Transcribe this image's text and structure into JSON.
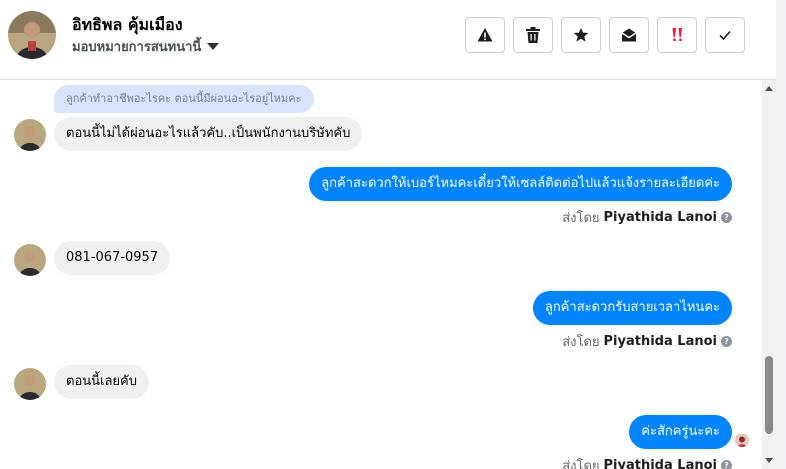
{
  "header": {
    "contact_name": "อิทธิพล คุ้มเมือง",
    "assign_label": "มอบหมายการสนทนานี้",
    "actions": [
      {
        "name": "alert-icon",
        "label": "spam"
      },
      {
        "name": "trash-icon",
        "label": "delete"
      },
      {
        "name": "star-icon",
        "label": "star"
      },
      {
        "name": "envelope-open-icon",
        "label": "mark unread"
      },
      {
        "name": "double-exclamation-icon",
        "label": "follow up"
      },
      {
        "name": "check-icon",
        "label": "done"
      }
    ],
    "accent_red": "#e41e3f"
  },
  "messages": {
    "quote_text": "ลูกค้าทำอาชีพอะไรคะ ตอนนี้มีผ่อนอะไรอยู่ไหมคะ",
    "m1": "ตอนนี้ไม่ได้ผ่อนอะไรแล้วคับ..เป็นพนักงานบริษัทคับ",
    "m2": "ลูกค้าสะดวกให้เบอร์ไหมคะเดี๋ยวให้เซลล์ติดต่อไปแล้วแจ้งรายละเอียดค่ะ",
    "m3": "081-067-0957",
    "m4": "ลูกค้าสะดวกรับสายเวลาไหนคะ",
    "m5": "ตอนนี้เลยคับ",
    "m6": "ค่ะสักครู่นะคะ",
    "sent_by_prefix": "ส่งโดย",
    "sent_by_name": "Piyathida Lanoi",
    "help_glyph": "?"
  },
  "colors": {
    "outgoing_bubble": "#0084ff",
    "incoming_bubble": "#f0f0f0",
    "quote_bubble": "#d8e4fb"
  }
}
